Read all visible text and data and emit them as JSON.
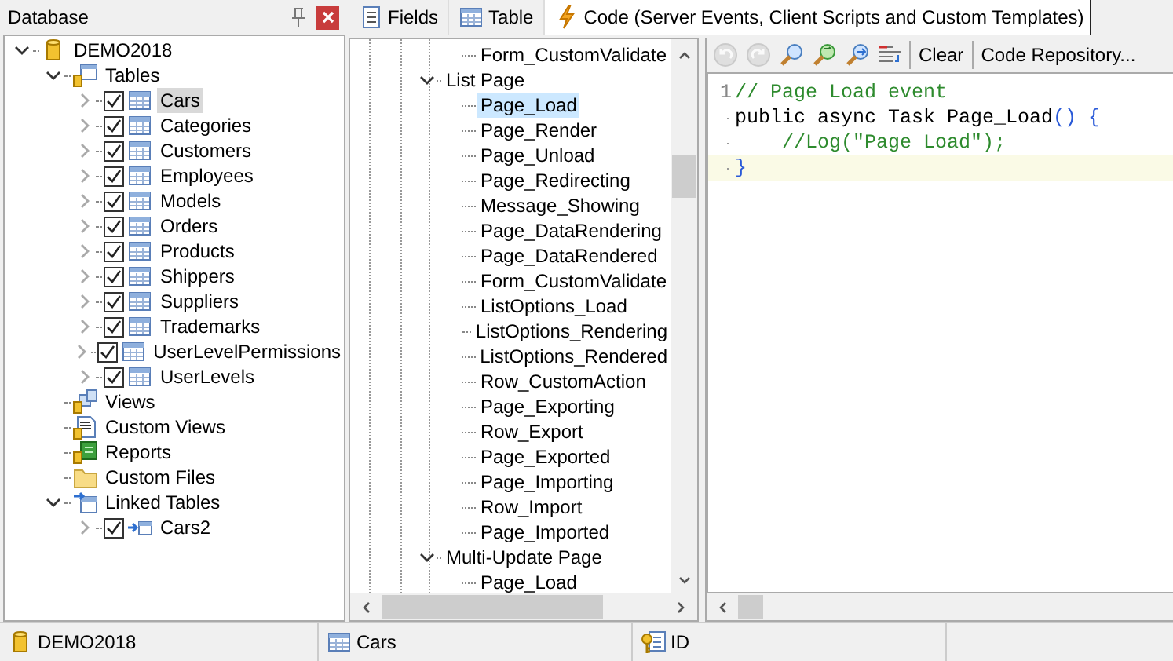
{
  "left_panel": {
    "title": "Database",
    "tree": [
      {
        "label": "DEMO2018",
        "kind": "database",
        "expanded": true,
        "selected": false,
        "children": [
          {
            "label": "Tables",
            "kind": "tables",
            "expanded": true,
            "selected": false,
            "children": [
              {
                "label": "Cars",
                "kind": "table",
                "expanded": false,
                "checked": true,
                "selected": true
              },
              {
                "label": "Categories",
                "kind": "table",
                "expanded": false,
                "checked": true,
                "selected": false
              },
              {
                "label": "Customers",
                "kind": "table",
                "expanded": false,
                "checked": true,
                "selected": false
              },
              {
                "label": "Employees",
                "kind": "table",
                "expanded": false,
                "checked": true,
                "selected": false
              },
              {
                "label": "Models",
                "kind": "table",
                "expanded": false,
                "checked": true,
                "selected": false
              },
              {
                "label": "Orders",
                "kind": "table",
                "expanded": false,
                "checked": true,
                "selected": false
              },
              {
                "label": "Products",
                "kind": "table",
                "expanded": false,
                "checked": true,
                "selected": false
              },
              {
                "label": "Shippers",
                "kind": "table",
                "expanded": false,
                "checked": true,
                "selected": false
              },
              {
                "label": "Suppliers",
                "kind": "table",
                "expanded": false,
                "checked": true,
                "selected": false
              },
              {
                "label": "Trademarks",
                "kind": "table",
                "expanded": false,
                "checked": true,
                "selected": false
              },
              {
                "label": "UserLevelPermissions",
                "kind": "table",
                "expanded": false,
                "checked": true,
                "selected": false
              },
              {
                "label": "UserLevels",
                "kind": "table",
                "expanded": false,
                "checked": true,
                "selected": false
              }
            ]
          },
          {
            "label": "Views",
            "kind": "views",
            "selected": false
          },
          {
            "label": "Custom Views",
            "kind": "sql",
            "selected": false
          },
          {
            "label": "Reports",
            "kind": "reports",
            "selected": false
          },
          {
            "label": "Custom Files",
            "kind": "folder",
            "selected": false
          },
          {
            "label": "Linked Tables",
            "kind": "linked",
            "expanded": true,
            "selected": false,
            "children": [
              {
                "label": "Cars2",
                "kind": "linked_table",
                "expanded": false,
                "checked": true,
                "selected": false
              }
            ]
          }
        ]
      }
    ]
  },
  "tabs": [
    {
      "label": "Fields",
      "kind": "fields",
      "selected": false
    },
    {
      "label": "Table",
      "kind": "table",
      "selected": false
    },
    {
      "label": "Code (Server Events, Client Scripts and Custom Templates)",
      "kind": "code",
      "selected": true
    }
  ],
  "events_tree": [
    {
      "children": [
        {
          "label": "Form_CustomValidate",
          "selected": false
        }
      ]
    },
    {
      "label": "List Page",
      "expanded": true,
      "selected": false,
      "children": [
        {
          "label": "Page_Load",
          "selected": true
        },
        {
          "label": "Page_Render",
          "selected": false
        },
        {
          "label": "Page_Unload",
          "selected": false
        },
        {
          "label": "Page_Redirecting",
          "selected": false
        },
        {
          "label": "Message_Showing",
          "selected": false
        },
        {
          "label": "Page_DataRendering",
          "selected": false
        },
        {
          "label": "Page_DataRendered",
          "selected": false
        },
        {
          "label": "Form_CustomValidate",
          "selected": false
        },
        {
          "label": "ListOptions_Load",
          "selected": false
        },
        {
          "label": "ListOptions_Rendering",
          "selected": false
        },
        {
          "label": "ListOptions_Rendered",
          "selected": false
        },
        {
          "label": "Row_CustomAction",
          "selected": false
        },
        {
          "label": "Page_Exporting",
          "selected": false
        },
        {
          "label": "Row_Export",
          "selected": false
        },
        {
          "label": "Page_Exported",
          "selected": false
        },
        {
          "label": "Page_Importing",
          "selected": false
        },
        {
          "label": "Row_Import",
          "selected": false
        },
        {
          "label": "Page_Imported",
          "selected": false
        }
      ]
    },
    {
      "label": "Multi-Update Page",
      "expanded": true,
      "selected": false,
      "children": [
        {
          "label": "Page_Load",
          "selected": false
        }
      ]
    }
  ],
  "editor": {
    "toolbar": {
      "icon_buttons": [
        {
          "kind": "undo",
          "disabled": true
        },
        {
          "kind": "redo",
          "disabled": true
        },
        {
          "kind": "find",
          "disabled": false
        },
        {
          "kind": "replace",
          "disabled": false
        },
        {
          "kind": "find_next",
          "disabled": false
        },
        {
          "kind": "format",
          "disabled": false
        }
      ],
      "text_buttons": [
        "Clear",
        "Code Repository..."
      ]
    },
    "lines": [
      {
        "number": "1",
        "current": false,
        "indented": false,
        "tokens": [
          {
            "kind": "comment",
            "text": "// Page Load event"
          }
        ]
      },
      {
        "current": false,
        "indented": false,
        "tokens": [
          {
            "kind": "plain",
            "text": "public async Task Page_Load"
          },
          {
            "kind": "punct",
            "text": "() {"
          }
        ]
      },
      {
        "current": false,
        "indented": true,
        "tokens": [
          {
            "kind": "comment",
            "text": "//Log(\"Page Load\");"
          }
        ]
      },
      {
        "current": true,
        "indented": false,
        "tokens": [
          {
            "kind": "punct",
            "text": "}"
          }
        ]
      }
    ]
  },
  "status_bar": [
    {
      "kind": "database",
      "text": "DEMO2018"
    },
    {
      "kind": "table",
      "text": "Cars"
    },
    {
      "kind": "key_field",
      "text": "ID"
    }
  ]
}
